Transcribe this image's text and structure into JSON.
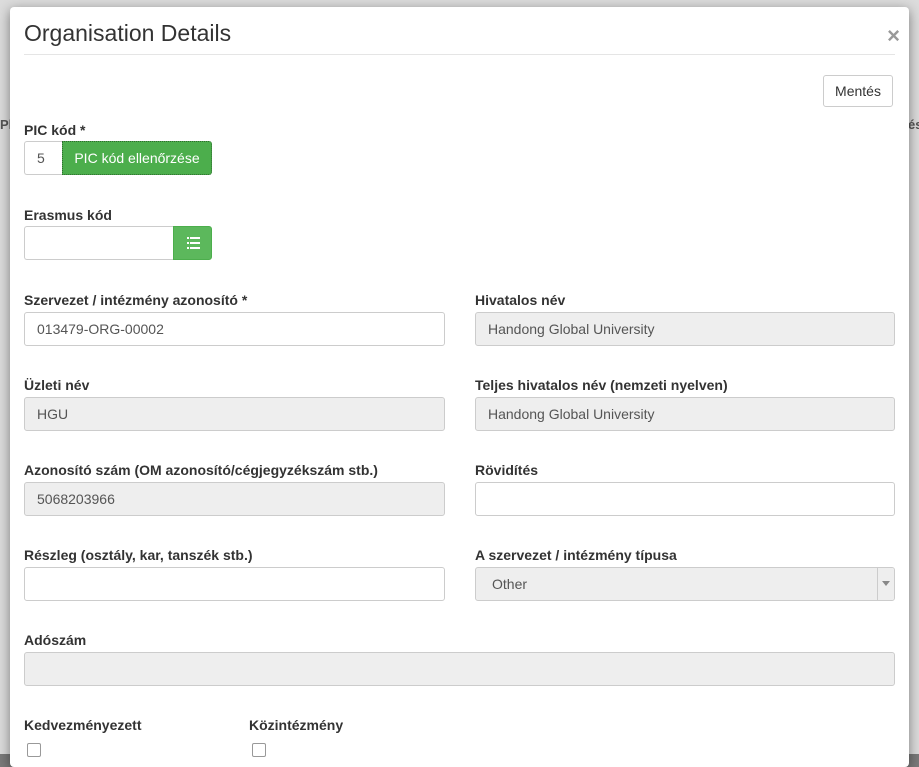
{
  "modal": {
    "title": "Organisation Details",
    "close_symbol": "×",
    "save_label": "Mentés"
  },
  "pic": {
    "label": "PIC kód *",
    "value": "5",
    "check_button": "PIC kód ellenőrzése"
  },
  "erasmus": {
    "label": "Erasmus kód",
    "value": "",
    "button_icon": "list-icon"
  },
  "fields": {
    "org_id": {
      "label": "Szervezet / intézmény azonosító *",
      "value": "013479-ORG-00002"
    },
    "official_name": {
      "label": "Hivatalos név",
      "value": "Handong Global University"
    },
    "business_name": {
      "label": "Üzleti név",
      "value": "HGU"
    },
    "full_official_name": {
      "label": "Teljes hivatalos név (nemzeti nyelven)",
      "value": "Handong Global University"
    },
    "id_number": {
      "label": "Azonosító szám (OM azonosító/cégjegyzékszám stb.)",
      "value": "5068203966"
    },
    "abbreviation": {
      "label": "Rövidítés",
      "value": ""
    },
    "department": {
      "label": "Részleg (osztály, kar, tanszék stb.)",
      "value": ""
    },
    "org_type": {
      "label": "A szervezet / intézmény típusa",
      "value": "Other"
    },
    "tax_number": {
      "label": "Adószám",
      "value": ""
    }
  },
  "checkboxes": {
    "beneficiary": {
      "label": "Kedvezményezett",
      "checked": false
    },
    "public_body": {
      "label": "Közintézmény",
      "checked": false
    }
  },
  "colors": {
    "success_green": "#5cb85c",
    "readonly_bg": "#eeeeee"
  }
}
